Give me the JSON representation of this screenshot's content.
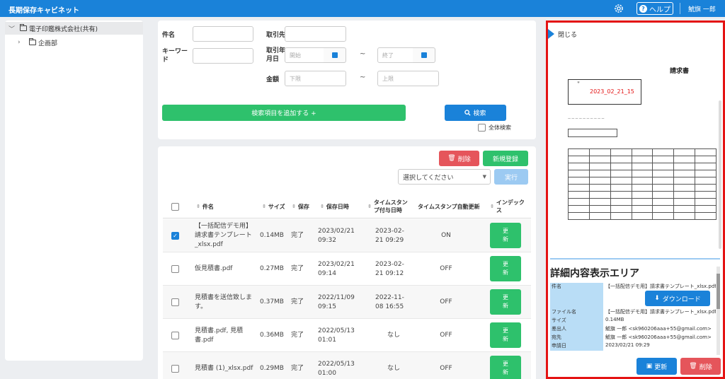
{
  "header": {
    "app_title": "長期保存キャビネット",
    "help_label": "ヘルプ",
    "user_name": "鯱旗 一郎"
  },
  "tree": {
    "root_label": "電子印鑑株式会社(共有)",
    "child_label": "企画部"
  },
  "search": {
    "subject_label": "件名",
    "keyword_label": "キーワード",
    "partner_label": "取引先",
    "date_label": "取引年月日",
    "date_start_placeholder": "開始",
    "date_end_placeholder": "終了",
    "amount_label": "金額",
    "amount_min_placeholder": "下限",
    "amount_max_placeholder": "上限",
    "range_sep": "~",
    "add_items_label": "検索項目を追加する +",
    "search_button": "検索",
    "full_search_label": "全体検索"
  },
  "results": {
    "delete_label": "削除",
    "new_label": "新規登録",
    "select_placeholder": "選択してください",
    "exec_label": "実行",
    "columns": {
      "subject": "件名",
      "size": "サイズ",
      "saved": "保存",
      "saved_at": "保存日時",
      "timestamp_at": "タイムスタンプ付与日時",
      "auto_update": "タイムスタンプ自動更新",
      "index": "インデックス"
    },
    "rows": [
      {
        "checked": true,
        "subject": "【一括配信デモ用】請求書テンプレート_xlsx.pdf",
        "size": "0.14MB",
        "status": "完了",
        "saved_at": "2023/02/21 09:32",
        "timestamp_at": "2023-02-21 09:29",
        "auto": "ON",
        "update": "更新"
      },
      {
        "checked": false,
        "subject": "仮見積書.pdf",
        "size": "0.27MB",
        "status": "完了",
        "saved_at": "2023/02/21 09:14",
        "timestamp_at": "2023-02-21 09:12",
        "auto": "OFF",
        "update": "更新"
      },
      {
        "checked": false,
        "subject": "見積書を送信致します。",
        "size": "0.37MB",
        "status": "完了",
        "saved_at": "2022/11/09 09:15",
        "timestamp_at": "2022-11-08 16:55",
        "auto": "OFF",
        "update": "更新"
      },
      {
        "checked": false,
        "subject": "見積書.pdf, 見積書.pdf",
        "size": "0.36MB",
        "status": "完了",
        "saved_at": "2022/05/13 01:01",
        "timestamp_at": "なし",
        "auto": "OFF",
        "update": "更新"
      },
      {
        "checked": false,
        "subject": "見積書 (1)_xlsx.pdf",
        "size": "0.29MB",
        "status": "完了",
        "saved_at": "2022/05/13 01:00",
        "timestamp_at": "なし",
        "auto": "OFF",
        "update": "更新"
      }
    ]
  },
  "preview": {
    "close_label": "閉じる",
    "doc_title": "請求書",
    "stamp_date": "2023_02_21_15",
    "detail_title": "詳細内容表示エリア",
    "download_label": "ダウンロード",
    "details": [
      {
        "key": "件名",
        "value": "【一括配信デモ用】請求書テンプレート_xlsx.pdf"
      },
      {
        "key": "",
        "value": ""
      },
      {
        "key": "",
        "value": ""
      },
      {
        "key": "ファイル名",
        "value": "【一括配信デモ用】請求書テンプレート_xlsx.pdf"
      },
      {
        "key": "サイズ",
        "value": "0.14MB"
      },
      {
        "key": "差出人",
        "value": "鯱旗 一郎 <sk960206aaa+55@gmail.com>"
      },
      {
        "key": "宛先",
        "value": "鯱旗 一郎 <sk960206aaa+55@gmail.com>"
      },
      {
        "key": "申請日",
        "value": "2023/02/21 09:29"
      }
    ],
    "update_label": "更新",
    "delete_label": "削除"
  }
}
